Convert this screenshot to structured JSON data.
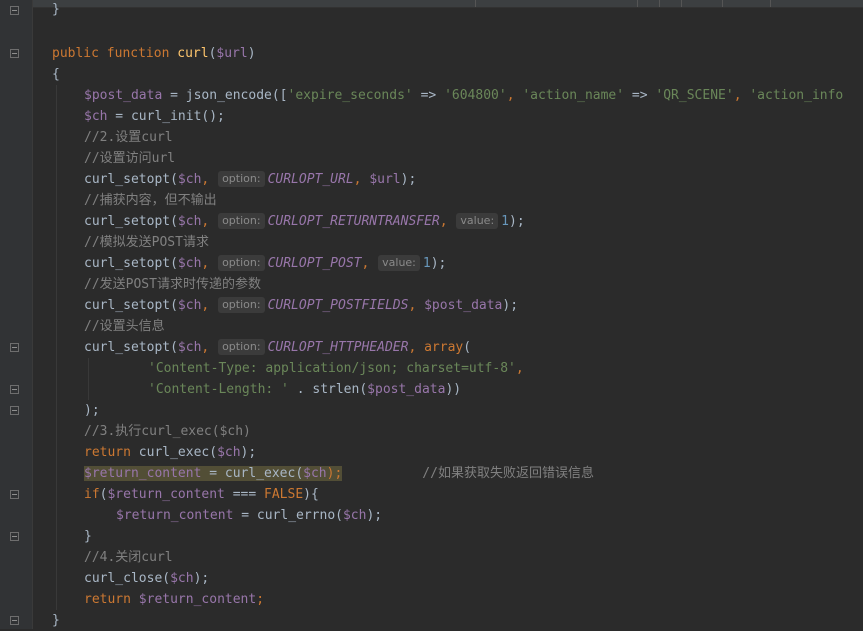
{
  "lines": {
    "l0": "}",
    "l1_kw1": "public",
    "l1_kw2": "function",
    "l1_fn": "curl",
    "l1_p1": "(",
    "l1_var": "$url",
    "l1_p2": ")",
    "l2": "{",
    "l3_var": "$post_data",
    "l3_eq": " = json_encode([",
    "l3_s1": "'expire_seconds'",
    "l3_arrow1": " => ",
    "l3_s2": "'604800'",
    "l3_comma1": ", ",
    "l3_s3": "'action_name'",
    "l3_arrow2": " => ",
    "l3_s4": "'QR_SCENE'",
    "l3_comma2": ", ",
    "l3_s5": "'action_info",
    "l4_var": "$ch",
    "l4_rest": " = curl_init();",
    "l5": "//2.设置curl",
    "l6": "//设置访问url",
    "l7_fn": "curl_setopt(",
    "l7_var": "$ch",
    "l7_c": ", ",
    "l7_hint": "option:",
    "l7_const": "CURLOPT_URL",
    "l7_c2": ", ",
    "l7_var2": "$url",
    "l7_end": ");",
    "l8": "//捕获内容，但不输出",
    "l9_fn": "curl_setopt(",
    "l9_var": "$ch",
    "l9_c": ", ",
    "l9_hint": "option:",
    "l9_const": "CURLOPT_RETURNTRANSFER",
    "l9_c2": ", ",
    "l9_hint2": "value:",
    "l9_num": "1",
    "l9_end": ");",
    "l10": "//模拟发送POST请求",
    "l11_fn": "curl_setopt(",
    "l11_var": "$ch",
    "l11_c": ", ",
    "l11_hint": "option:",
    "l11_const": "CURLOPT_POST",
    "l11_c2": ", ",
    "l11_hint2": "value:",
    "l11_num": "1",
    "l11_end": ");",
    "l12": "//发送POST请求时传递的参数",
    "l13_fn": "curl_setopt(",
    "l13_var": "$ch",
    "l13_c": ", ",
    "l13_hint": "option:",
    "l13_const": "CURLOPT_POSTFIELDS",
    "l13_c2": ", ",
    "l13_var2": "$post_data",
    "l13_end": ");",
    "l14": "//设置头信息",
    "l15_fn": "curl_setopt(",
    "l15_var": "$ch",
    "l15_c": ", ",
    "l15_hint": "option:",
    "l15_const": "CURLOPT_HTTPHEADER",
    "l15_c2": ", ",
    "l15_kw": "array",
    "l15_end": "(",
    "l16_str": "'Content-Type: application/json; charset=utf-8'",
    "l16_end": ",",
    "l17_str": "'Content-Length: '",
    "l17_mid": " . strlen(",
    "l17_var": "$post_data",
    "l17_end": "))",
    "l18": ");",
    "l19": "//3.执行curl_exec($ch)",
    "l20_kw": "return",
    "l20_mid": " curl_exec(",
    "l20_var": "$ch",
    "l20_end": ");",
    "l21_var": "$return_content",
    "l21_mid": " = curl_exec(",
    "l21_var2": "$ch",
    "l21_end": ");",
    "l21_cm": "//如果获取失败返回错误信息",
    "l22_kw": "if",
    "l22_p": "(",
    "l22_var": "$return_content",
    "l22_op": " === ",
    "l22_kw2": "FALSE",
    "l22_end": "){",
    "l23_var": "$return_content",
    "l23_mid": " = curl_errno(",
    "l23_var2": "$ch",
    "l23_end": ");",
    "l24": "}",
    "l25": "//4.关闭curl",
    "l26_fn": "curl_close(",
    "l26_var": "$ch",
    "l26_end": ");",
    "l27_kw": "return",
    "l27_sp": " ",
    "l27_var": "$return_content",
    "l27_end": ";",
    "l28": "}"
  },
  "colors": {
    "background": "#2b2b2b",
    "keyword": "#cc7832",
    "function": "#ffc66d",
    "variable": "#9876aa",
    "string": "#6a8759",
    "comment": "#808080",
    "number": "#6897bb",
    "highlight": "#524e36"
  }
}
